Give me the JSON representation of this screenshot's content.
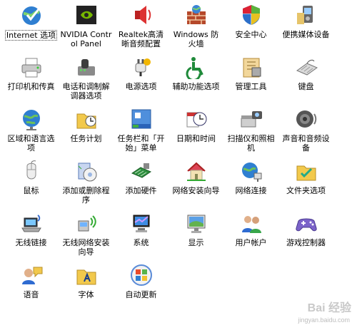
{
  "items": [
    {
      "name": "internet-options",
      "label": "Internet 选项",
      "icon": "globe-check-icon",
      "selected": true
    },
    {
      "name": "nvidia-control-panel",
      "label": "NVIDIA Control Panel",
      "icon": "nvidia-icon"
    },
    {
      "name": "realtek-audio",
      "label": "Realtek高清晰音频配置",
      "icon": "speaker-icon"
    },
    {
      "name": "windows-firewall",
      "label": "Windows 防火墙",
      "icon": "firewall-brick-icon"
    },
    {
      "name": "security-center",
      "label": "安全中心",
      "icon": "shield-icon"
    },
    {
      "name": "portable-media",
      "label": "便携媒体设备",
      "icon": "media-device-icon"
    },
    {
      "name": "printers-fax",
      "label": "打印机和传真",
      "icon": "printer-icon"
    },
    {
      "name": "phone-modem",
      "label": "电话和调制解调器选项",
      "icon": "phone-modem-icon"
    },
    {
      "name": "power-options",
      "label": "电源选项",
      "icon": "power-plug-icon"
    },
    {
      "name": "accessibility",
      "label": "辅助功能选项",
      "icon": "accessibility-icon"
    },
    {
      "name": "admin-tools",
      "label": "管理工具",
      "icon": "tools-icon"
    },
    {
      "name": "keyboard",
      "label": "键盘",
      "icon": "keyboard-icon"
    },
    {
      "name": "regional-language",
      "label": "区域和语言选项",
      "icon": "globe-icon"
    },
    {
      "name": "scheduled-tasks",
      "label": "任务计划",
      "icon": "scheduled-folder-icon"
    },
    {
      "name": "taskbar-start",
      "label": "任务栏和「开始」菜单",
      "icon": "taskbar-icon"
    },
    {
      "name": "date-time",
      "label": "日期和时间",
      "icon": "clock-calendar-icon"
    },
    {
      "name": "scanners-cameras",
      "label": "扫描仪和照相机",
      "icon": "scanner-camera-icon"
    },
    {
      "name": "sounds-audio",
      "label": "声音和音频设备",
      "icon": "speaker-round-icon"
    },
    {
      "name": "mouse",
      "label": "鼠标",
      "icon": "mouse-icon"
    },
    {
      "name": "add-remove-programs",
      "label": "添加或删除程序",
      "icon": "add-remove-icon"
    },
    {
      "name": "add-hardware",
      "label": "添加硬件",
      "icon": "hardware-icon"
    },
    {
      "name": "network-wizard",
      "label": "网络安装向导",
      "icon": "home-network-icon"
    },
    {
      "name": "network-connections",
      "label": "网络连接",
      "icon": "network-globe-icon"
    },
    {
      "name": "folder-options",
      "label": "文件夹选项",
      "icon": "folder-check-icon"
    },
    {
      "name": "wireless-link",
      "label": "无线链接",
      "icon": "wireless-laptop-icon"
    },
    {
      "name": "wireless-network-wizard",
      "label": "无线网络安装向导",
      "icon": "wireless-wizard-icon"
    },
    {
      "name": "system",
      "label": "系统",
      "icon": "system-monitor-icon"
    },
    {
      "name": "display",
      "label": "显示",
      "icon": "display-icon"
    },
    {
      "name": "user-accounts",
      "label": "用户帐户",
      "icon": "users-icon"
    },
    {
      "name": "game-controllers",
      "label": "游戏控制器",
      "icon": "gamepad-icon"
    },
    {
      "name": "speech",
      "label": "语音",
      "icon": "speech-icon"
    },
    {
      "name": "fonts",
      "label": "字体",
      "icon": "fonts-folder-icon"
    },
    {
      "name": "automatic-updates",
      "label": "自动更新",
      "icon": "windows-update-icon"
    }
  ],
  "watermark": {
    "brand": "Bai 经验",
    "url": "jingyan.baidu.com"
  }
}
